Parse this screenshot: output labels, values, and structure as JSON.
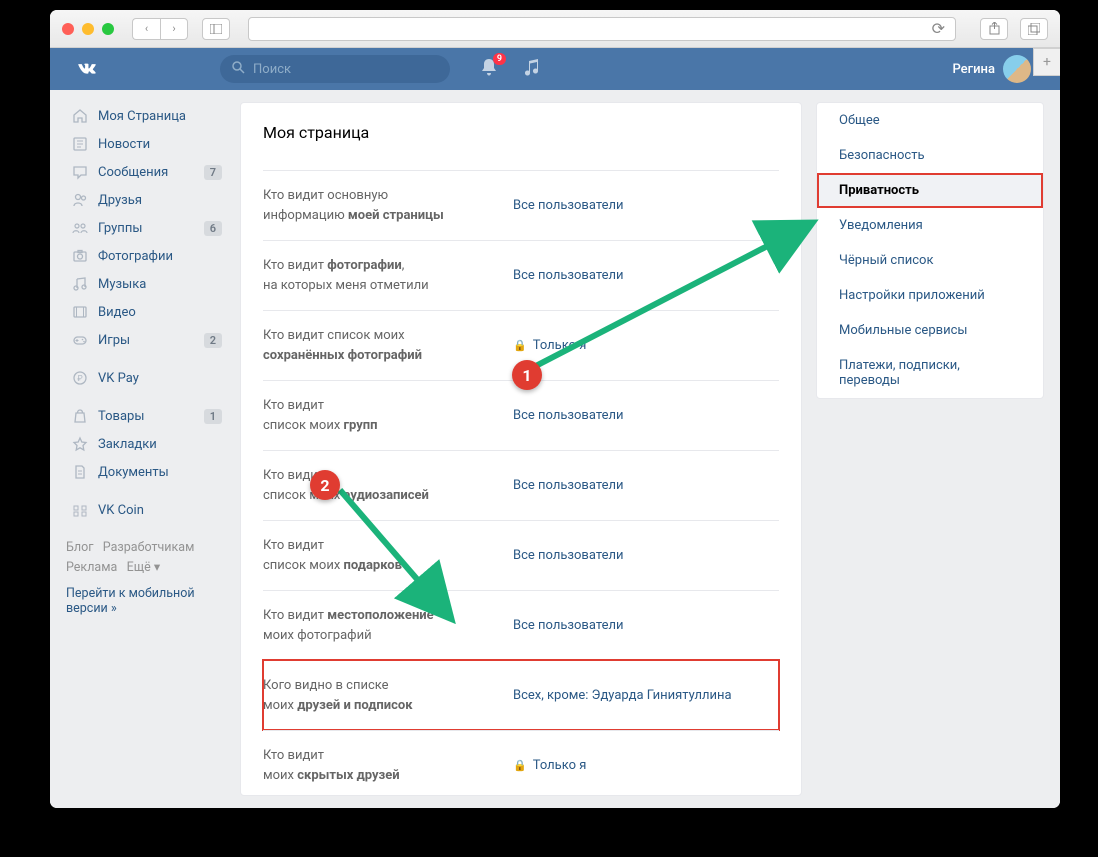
{
  "notification_badge": "9",
  "search_placeholder": "Поиск",
  "user_name": "Регина",
  "nav_items": [
    {
      "icon": "home",
      "label": "Моя Страница",
      "badge": ""
    },
    {
      "icon": "news",
      "label": "Новости",
      "badge": ""
    },
    {
      "icon": "msg",
      "label": "Сообщения",
      "badge": "7"
    },
    {
      "icon": "friends",
      "label": "Друзья",
      "badge": ""
    },
    {
      "icon": "groups",
      "label": "Группы",
      "badge": "6"
    },
    {
      "icon": "photo",
      "label": "Фотографии",
      "badge": ""
    },
    {
      "icon": "music",
      "label": "Музыка",
      "badge": ""
    },
    {
      "icon": "video",
      "label": "Видео",
      "badge": ""
    },
    {
      "icon": "games",
      "label": "Игры",
      "badge": "2"
    }
  ],
  "nav_items2": [
    {
      "icon": "pay",
      "label": "VK Pay",
      "badge": ""
    }
  ],
  "nav_items3": [
    {
      "icon": "market",
      "label": "Товары",
      "badge": "1"
    },
    {
      "icon": "star",
      "label": "Закладки",
      "badge": ""
    },
    {
      "icon": "docs",
      "label": "Документы",
      "badge": ""
    }
  ],
  "nav_items4": [
    {
      "icon": "coin",
      "label": "VK Coin",
      "badge": ""
    }
  ],
  "footer": {
    "blog": "Блог",
    "dev": "Разработчикам",
    "ads": "Реклама",
    "more": "Ещё ▾"
  },
  "mobile_link_1": "Перейти к мобильной",
  "mobile_link_2": "версии »",
  "page_title": "Моя страница",
  "settings": [
    {
      "l1": "Кто видит основную",
      "l2": "информацию ",
      "b": "моей страницы",
      "val": "Все пользователи",
      "lock": false,
      "hl": false
    },
    {
      "l1": "Кто видит ",
      "b": "фотографии",
      "l2": "на которых меня отметили",
      "val": "Все пользователи",
      "lock": false,
      "hl": false,
      "bAfter": ","
    },
    {
      "l1": "Кто видит список моих",
      "l2": "",
      "b": "сохранённых фотографий",
      "val": "Только я",
      "lock": true,
      "hl": false
    },
    {
      "l1": "Кто видит",
      "l2": "список моих ",
      "b": "групп",
      "val": "Все пользователи",
      "lock": false,
      "hl": false
    },
    {
      "l1": "Кто видит",
      "l2": "список моих ",
      "b": "аудиозаписей",
      "val": "Все пользователи",
      "lock": false,
      "hl": false,
      "obscured": true
    },
    {
      "l1": "Кто видит",
      "l2": "список моих ",
      "b": "подарков",
      "val": "Все пользователи",
      "lock": false,
      "hl": false,
      "obscured": true
    },
    {
      "l1": "Кто видит ",
      "b": "местоположение",
      "l2": "моих фотографий",
      "val": "Все пользователи",
      "lock": false,
      "hl": false
    },
    {
      "l1": "Кого видно в списке",
      "l2": "моих ",
      "b": "друзей и подписок",
      "val": "Всех, кроме: Эдуарда Гиниятуллина",
      "lock": false,
      "hl": true
    },
    {
      "l1": "Кто видит",
      "l2": "моих ",
      "b": "скрытых друзей",
      "val": "Только я",
      "lock": true,
      "hl": false
    }
  ],
  "rtabs": [
    {
      "label": "Общее",
      "active": false,
      "hl": false
    },
    {
      "label": "Безопасность",
      "active": false,
      "hl": false
    },
    {
      "label": "Приватность",
      "active": true,
      "hl": true
    },
    {
      "label": "Уведомления",
      "active": false,
      "hl": false
    },
    {
      "label": "Чёрный список",
      "active": false,
      "hl": false
    },
    {
      "label": "Настройки приложений",
      "active": false,
      "hl": false
    },
    {
      "label": "Мобильные сервисы",
      "active": false,
      "hl": false
    },
    {
      "label": "Платежи, подписки, переводы",
      "active": false,
      "hl": false
    }
  ],
  "annotations": {
    "circle1": "1",
    "circle2": "2"
  }
}
